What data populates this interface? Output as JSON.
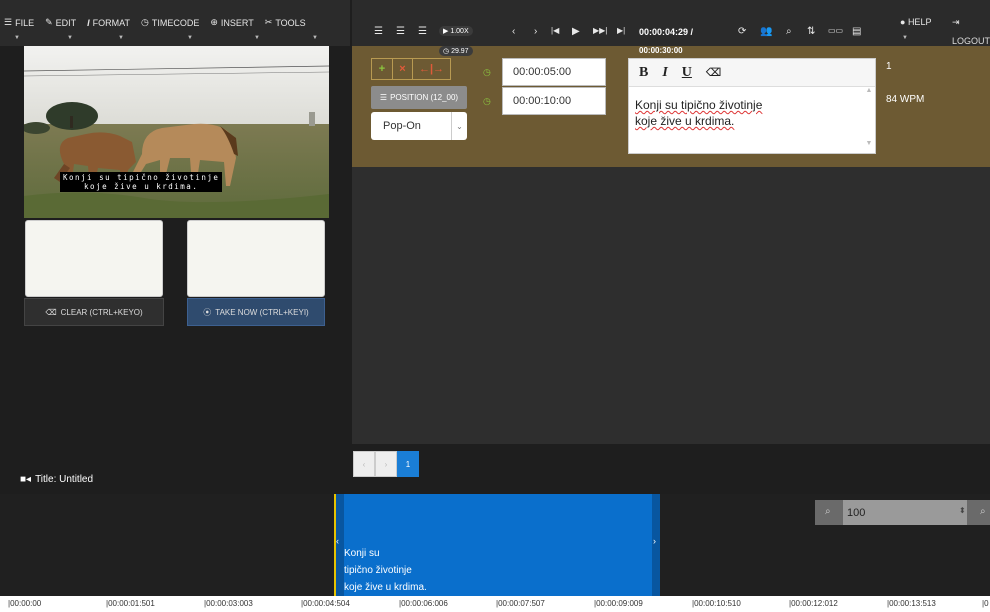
{
  "menu": {
    "file": "FILE",
    "edit": "EDIT",
    "format": "FORMAT",
    "timecode": "TIMECODE",
    "insert": "INSERT",
    "tools": "TOOLS"
  },
  "toolbar": {
    "speed": "1.00X",
    "fps": "29.97",
    "current_time": "00:00:04:29 /",
    "total_time": "00:00:30:00",
    "help": "HELP",
    "logout": "LOGOUT"
  },
  "video": {
    "caption_line1": "Konji su tipično životinje",
    "caption_line2": "koje žive u krdima."
  },
  "buttons": {
    "clear": "CLEAR (CTRL+KEYO)",
    "take_now": "TAKE NOW (CTRL+KEYI)"
  },
  "caption": {
    "position_label": "POSITION (12_00)",
    "mode": "Pop-On",
    "start_time": "00:00:05:00",
    "end_time": "00:00:10:00",
    "text_line1": "Konji su tipično životinje",
    "text_line2": "koje žive u krdima.",
    "number": "1",
    "wpm": "84 WPM"
  },
  "pager": {
    "current": "1"
  },
  "project": {
    "title": "Title: Untitled"
  },
  "timeline": {
    "block_line1": "Konji su",
    "block_line2": "tipično životinje",
    "block_line3": "koje žive u krdima.",
    "zoom": "100",
    "ruler": [
      "|00:00:00",
      "|00:00:01:501",
      "|00:00:03:003",
      "|00:00:04:504",
      "|00:00:06:006",
      "|00:00:07:507",
      "|00:00:09:009",
      "|00:00:10:510",
      "|00:00:12:012",
      "|00:00:13:513",
      "|0"
    ]
  },
  "colors": {
    "caption_row": "#6d5a33",
    "timeline_block": "#0a6fcc",
    "accent_green": "#8cc63f",
    "accent_red": "#e05a3a"
  }
}
